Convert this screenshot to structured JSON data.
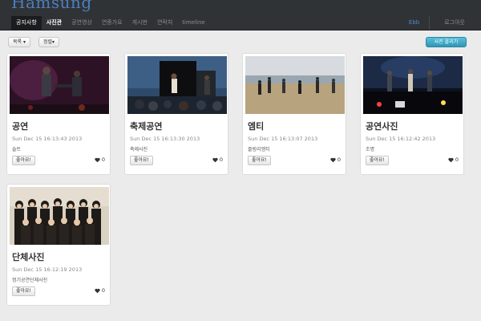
{
  "brand": "Hamsung",
  "nav": {
    "items": [
      "공지사항",
      "사진관",
      "공연영상",
      "연중가요",
      "게시판",
      "연락처",
      "timeline"
    ],
    "user": "Ebb",
    "logout": "로그아웃"
  },
  "toolbar": {
    "sort": "목록 ▾",
    "align": "정렬▾",
    "upload": "사진 올리기"
  },
  "cards": [
    {
      "title": "공연",
      "date": "Sun Dec 15 16:13:43 2013",
      "desc": "솔트",
      "like": "좋아요!",
      "likes": "0"
    },
    {
      "title": "축제공연",
      "date": "Sun Dec 15 16:13:30 2013",
      "desc": "축제사진",
      "like": "좋아요!",
      "likes": "0"
    },
    {
      "title": "엠티",
      "date": "Sun Dec 15 16:13:07 2013",
      "desc": "즐링리엠티",
      "like": "좋아요!",
      "likes": "0"
    },
    {
      "title": "공연사진",
      "date": "Sun Dec 15 16:12:42 2013",
      "desc": "조명",
      "like": "좋아요!",
      "likes": "0"
    },
    {
      "title": "단체사진",
      "date": "Sun Dec 15 16:12:19 2013",
      "desc": "정기공연단체사진",
      "like": "좋아요!",
      "likes": "0"
    }
  ],
  "colors": {
    "navbar": "#303336",
    "brand": "#4b7fbd",
    "primary_button": "#2f96b4",
    "page_background": "#ebebeb"
  }
}
